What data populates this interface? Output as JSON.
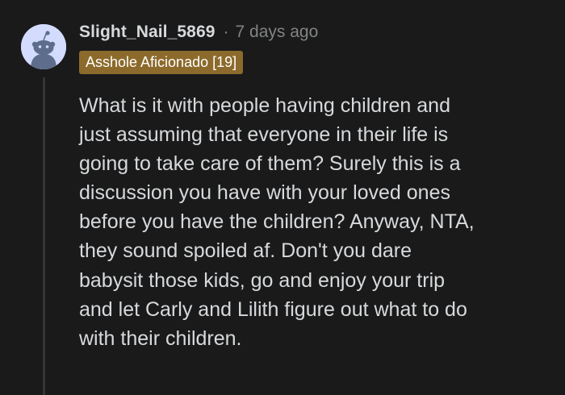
{
  "comment": {
    "username": "Slight_Nail_5869",
    "separator": "·",
    "timestamp": "7 days ago",
    "flair": "Asshole Aficionado [19]",
    "body": "What is it with people having children and\njust assuming that everyone in their life is\ngoing to take care of them? Surely this is a\ndiscussion you have with your loved ones\nbefore you have the children? Anyway, NTA,\nthey sound spoiled af. Don't you dare\nbabysit those kids, go and enjoy your trip\nand let Carly and Lilith figure out what to do\nwith their children."
  },
  "colors": {
    "background": "#1a1a1b",
    "text": "#d7dadc",
    "muted": "#818384",
    "flair_bg": "#8c6a2b",
    "avatar_bg": "#d3dcff",
    "thread_line": "#343536"
  },
  "icons": {
    "avatar": "reddit-snoo-default-avatar"
  }
}
